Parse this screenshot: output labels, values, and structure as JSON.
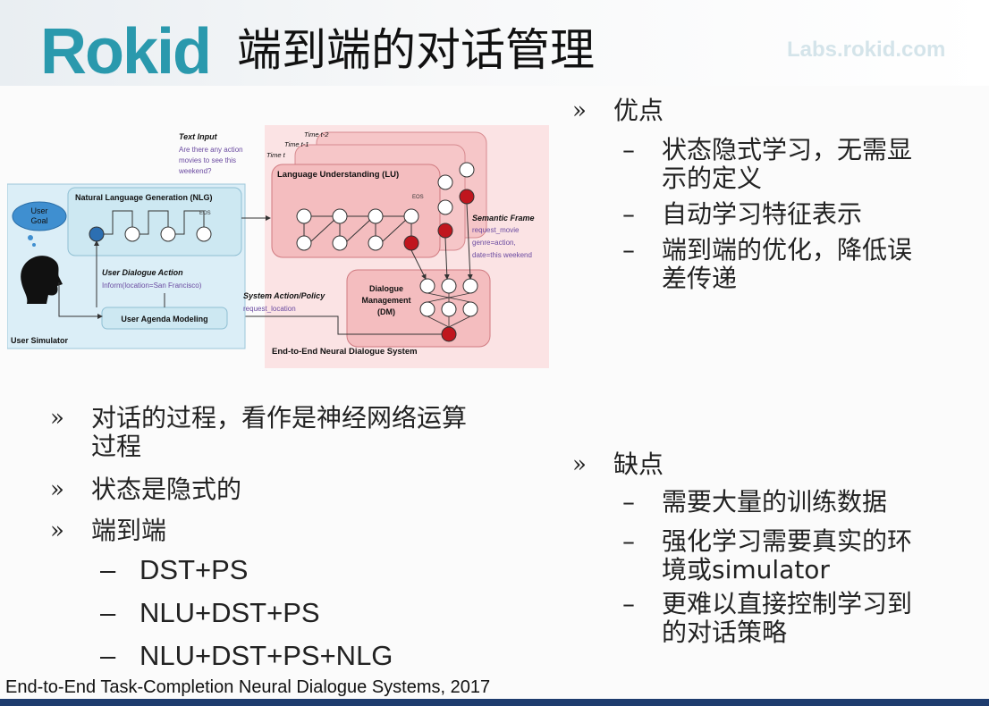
{
  "header": {
    "logo": "Rokid",
    "title": "端到端的对话管理",
    "site": "Labs.rokid.com"
  },
  "diagram": {
    "text_input_title": "Text Input",
    "text_input_lines": [
      "Are there any action",
      "movies to see this",
      "weekend?"
    ],
    "time_labels": [
      "Time t-2",
      "Time t-1",
      "Time t"
    ],
    "user_goal": [
      "User",
      "Goal"
    ],
    "nlg_title": "Natural Language Generation (NLG)",
    "lu_title": "Language Understanding (LU)",
    "eos": "EOS",
    "user_dialogue_action": "User Dialogue Action",
    "inform": "Inform(location=San Francisco)",
    "user_agenda": "User Agenda Modeling",
    "user_simulator": "User Simulator",
    "system_action": "System Action/Policy",
    "request_location": "request_location",
    "semantic_frame": "Semantic Frame",
    "frame_lines": [
      "request_movie",
      "genre=action,",
      "date=this weekend"
    ],
    "dm_lines": [
      "Dialogue",
      "Management",
      "(DM)"
    ],
    "e2e_caption": "End-to-End Neural Dialogue System"
  },
  "right": {
    "pros_label": "优点",
    "pros": [
      {
        "lines": [
          "状态隐式学习，无需显",
          "示的定义"
        ]
      },
      {
        "lines": [
          "自动学习特征表示"
        ]
      },
      {
        "lines": [
          "端到端的优化，降低误",
          "差传递"
        ]
      }
    ],
    "cons_label": "缺点",
    "cons": [
      {
        "lines": [
          "需要大量的训练数据"
        ]
      },
      {
        "lines": [
          "强化学习需要真实的环",
          "境或simulator"
        ]
      },
      {
        "lines": [
          "更难以直接控制学习到",
          "的对话策略"
        ]
      }
    ]
  },
  "left": {
    "items": [
      {
        "lines": [
          "对话的过程，看作是神经网络运算",
          "过程"
        ]
      },
      {
        "lines": [
          "状态是隐式的"
        ]
      },
      {
        "lines": [
          "端到端"
        ]
      }
    ],
    "sub": [
      "DST+PS",
      "NLU+DST+PS",
      "NLU+DST+PS+NLG"
    ]
  },
  "markers": {
    "bullet": "»",
    "dash": "–"
  },
  "footer": "End-to-End Task-Completion Neural Dialogue Systems, 2017",
  "colors": {
    "logo": "#2a99ad",
    "pink_box": "#f6c6c8",
    "blue_box": "#cde8f2",
    "red_node": "#c0161e",
    "blue_node": "#2c6fb2",
    "bottom_bar": "#1e3c6e"
  }
}
